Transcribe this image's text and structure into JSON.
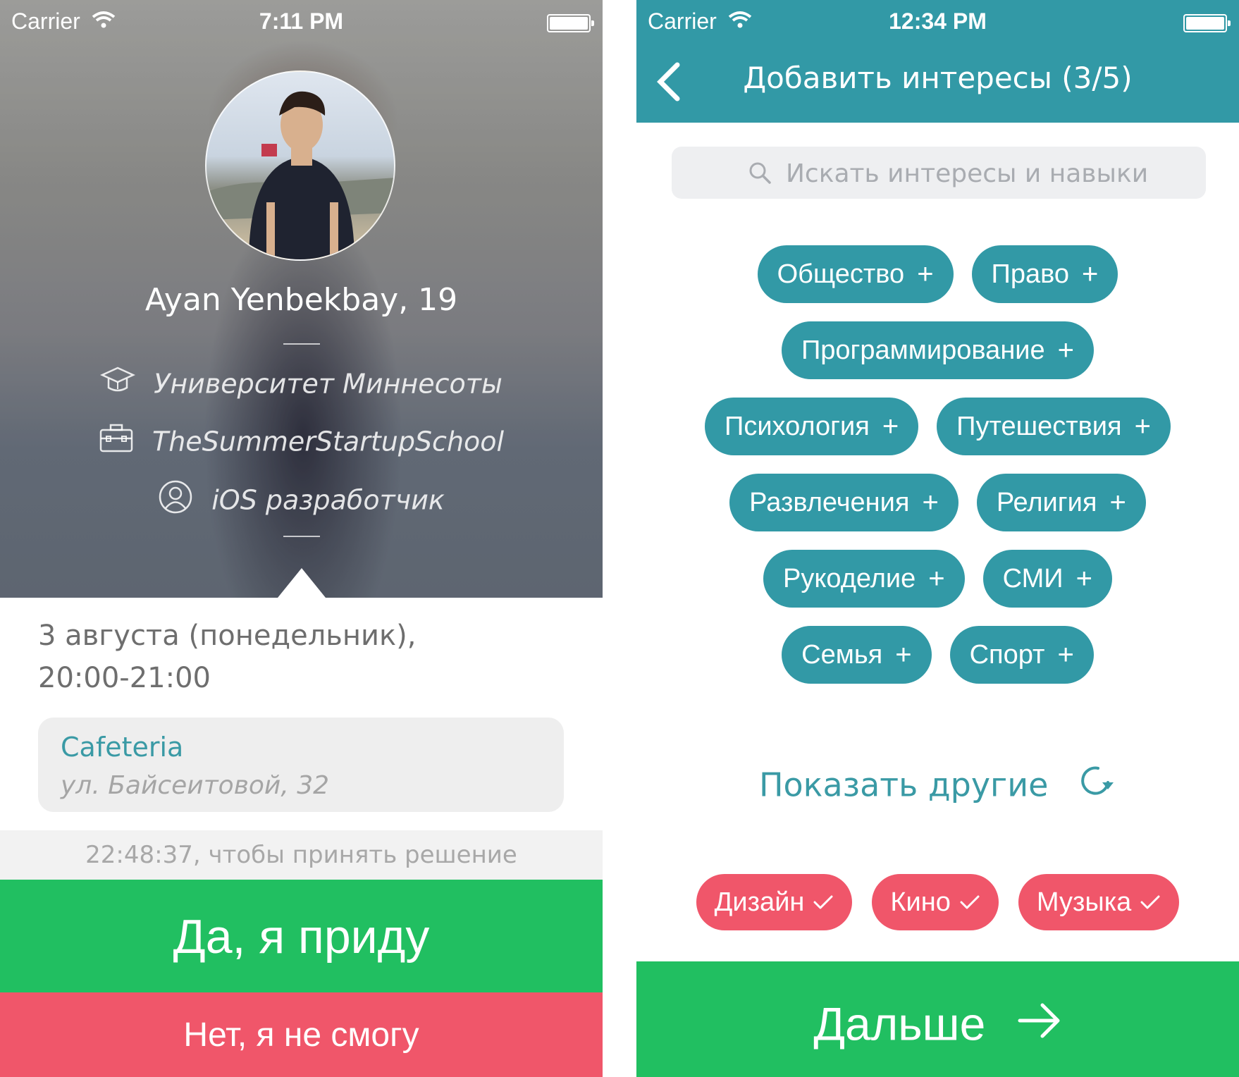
{
  "left": {
    "status": {
      "carrier": "Carrier",
      "time": "7:11 PM"
    },
    "profile": {
      "name": "Ayan Yenbekbay, 19",
      "university": "Университет Миннесоты",
      "company": "TheSummerStartupSchool",
      "role": "iOS разработчик"
    },
    "event": {
      "date_line1": "3 августа (понедельник),",
      "date_line2": "20:00-21:00",
      "place_name": "Cafeteria",
      "place_address": "ул. Байсеитовой, 32",
      "timer": "22:48:37, чтобы принять решение"
    },
    "actions": {
      "accept": "Да, я приду",
      "decline": "Нет, я не смогу"
    }
  },
  "right": {
    "status": {
      "carrier": "Carrier",
      "time": "12:34 PM"
    },
    "title": "Добавить интересы (3/5)",
    "search": {
      "placeholder": "Искать интересы и навыки"
    },
    "interests": [
      [
        "Общество",
        "Право"
      ],
      [
        "Программирование"
      ],
      [
        "Психология",
        "Путешествия"
      ],
      [
        "Развлечения",
        "Религия"
      ],
      [
        "Рукоделие",
        "СМИ"
      ],
      [
        "Семья",
        "Спорт"
      ]
    ],
    "show_more": "Показать другие",
    "selected": [
      "Дизайн",
      "Кино",
      "Музыка"
    ],
    "next": "Дальше"
  },
  "colors": {
    "teal": "#3299a6",
    "green": "#21bf61",
    "red": "#f0566a"
  }
}
